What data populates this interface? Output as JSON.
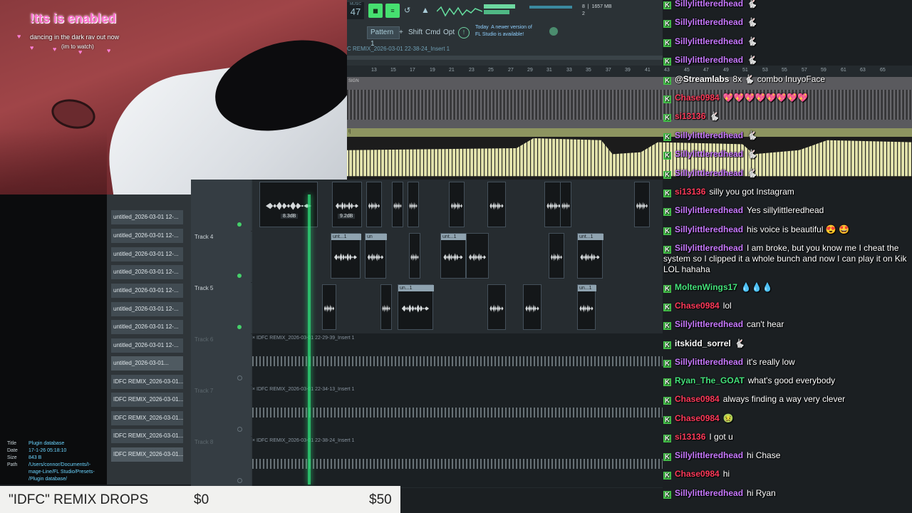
{
  "overlay": {
    "tts_title": "!tts is enabled",
    "line1": "dancing in the dark rav out now",
    "line2": "(im to watch)"
  },
  "toolbar": {
    "tempo": "47",
    "tempo_label": "MUSIC",
    "pattern": "Pattern 1",
    "plus": "+",
    "shift": "Shift",
    "cmd": "Cmd",
    "opt": "Opt",
    "news": "Today  A newer version of\nFL Studio is available!",
    "path": "C REMIX_2026-03-01 22-38-24_Insert 1",
    "ram": "8  |  1657 MB\n2"
  },
  "ruler": {
    "numbers": [
      "13",
      "15",
      "17",
      "19",
      "21",
      "23",
      "25",
      "27",
      "29",
      "31",
      "33",
      "35",
      "37",
      "39",
      "41",
      "43",
      "45",
      "47",
      "49",
      "51",
      "53",
      "55",
      "57",
      "59",
      "61",
      "63",
      "65"
    ]
  },
  "tracks_top": {
    "t1_label": "SIGN",
    "t2_label": "I]"
  },
  "browser": {
    "items": [
      "untitled_2026-03-01 12-...",
      "untitled_2026-03-01 12-...",
      "untitled_2026-03-01 12-...",
      "untitled_2026-03-01 12-...",
      "untitled_2026-03-01 12-...",
      "untitled_2026-03-01 12-...",
      "untitled_2026-03-01 12-...",
      "untitled_2026-03-01 12-...",
      "untitled_2026-03-01...",
      "IDFC REMIX_2026-03-01...",
      "IDFC REMIX_2026-03-01...",
      "IDFC REMIX_2026-03-01...",
      "IDFC REMIX_2026-03-01...",
      "IDFC REMIX_2026-03-01..."
    ],
    "info_title_k": "Title",
    "info_title_v": "Plugin database",
    "info_date_k": "Date",
    "info_date_v": "17-1-26 05:18:10",
    "info_size_k": "Size",
    "info_size_v": "843 B",
    "info_path_k": "Path",
    "info_path_v": "/Users/connor/Documents/I-",
    "info_path_v2": "mage-Line/FL Studio/Presets-",
    "info_path_v3": "/Plugin database/"
  },
  "playlist": {
    "db1": "8.3dB",
    "db2": "9.2dB",
    "track4": "Track 4",
    "track5": "Track 5",
    "track6": "Track 6",
    "track7": "Track 7",
    "track8": "Track 8",
    "clip_unt": "unt...1",
    "clip_un": "un",
    "clip_un1": "un...1",
    "long6": "× IDFC REMIX_2026-03-01 22-29-39_Insert 1",
    "long7": "× IDFC REMIX_2026-03-01 22-34-13_Insert 1",
    "long8": "× IDFC REMIX_2026-03-01 22-38-24_Insert 1"
  },
  "chat": [
    {
      "user": "Sillylittleredhead",
      "color": "#c879ff",
      "text": "🐇"
    },
    {
      "user": "Sillylittleredhead",
      "color": "#c879ff",
      "text": "🐇"
    },
    {
      "user": "Sillylittleredhead",
      "color": "#c879ff",
      "text": "🐇"
    },
    {
      "user": "Sillylittleredhead",
      "color": "#c879ff",
      "text": "🐇"
    },
    {
      "user": "@Streamlabs",
      "color": "#ffffff",
      "text": "8x 🐇 combo InuyoFace"
    },
    {
      "user": "Chase0984",
      "color": "#ff3a5a",
      "text": "💖💖💖💖💖💖💖💖"
    },
    {
      "user": "si13136",
      "color": "#ff3a5a",
      "text": "🐇"
    },
    {
      "user": "Sillylittleredhead",
      "color": "#c879ff",
      "text": "🐇"
    },
    {
      "user": "Sillylittleredhead",
      "color": "#c879ff",
      "text": "🐇"
    },
    {
      "user": "Sillylittleredhead",
      "color": "#c879ff",
      "text": "🐇"
    },
    {
      "user": "si13136",
      "color": "#ff3a5a",
      "text": "silly you got Instagram"
    },
    {
      "user": "Sillylittleredhead",
      "color": "#c879ff",
      "text": "Yes sillylittleredhead"
    },
    {
      "user": "Sillylittleredhead",
      "color": "#c879ff",
      "text": "his voice is beautiful 😍 🤩"
    },
    {
      "user": "Sillylittleredhead",
      "color": "#c879ff",
      "text": "I am broke, but you know me I cheat the system so I clipped it a whole bunch and now I can play it on Kik LOL hahaha"
    },
    {
      "user": "MoltenWings17",
      "color": "#44e07a",
      "text": "💧💧💧"
    },
    {
      "user": "Chase0984",
      "color": "#ff3a5a",
      "text": "lol"
    },
    {
      "user": "Sillylittleredhead",
      "color": "#c879ff",
      "text": "can't hear"
    },
    {
      "user": "itskidd_sorrel",
      "color": "#ffffff",
      "text": "🐇"
    },
    {
      "user": "Sillylittleredhead",
      "color": "#c879ff",
      "text": "it's really low"
    },
    {
      "user": "Ryan_The_GOAT",
      "color": "#44e07a",
      "text": "what's good everybody"
    },
    {
      "user": "Chase0984",
      "color": "#ff3a5a",
      "text": "always finding a way very clever"
    },
    {
      "user": "Chase0984",
      "color": "#ff3a5a",
      "text": "🤢"
    },
    {
      "user": "si13136",
      "color": "#ff3a5a",
      "text": "I got u"
    },
    {
      "user": "Sillylittleredhead",
      "color": "#c879ff",
      "text": "hi Chase"
    },
    {
      "user": "Chase0984",
      "color": "#ff3a5a",
      "text": "hi"
    },
    {
      "user": "Sillylittleredhead",
      "color": "#c879ff",
      "text": "hi Ryan"
    }
  ],
  "banner": {
    "title": "\"IDFC\" REMIX DROPS",
    "start": "$0",
    "goal": "$50"
  }
}
